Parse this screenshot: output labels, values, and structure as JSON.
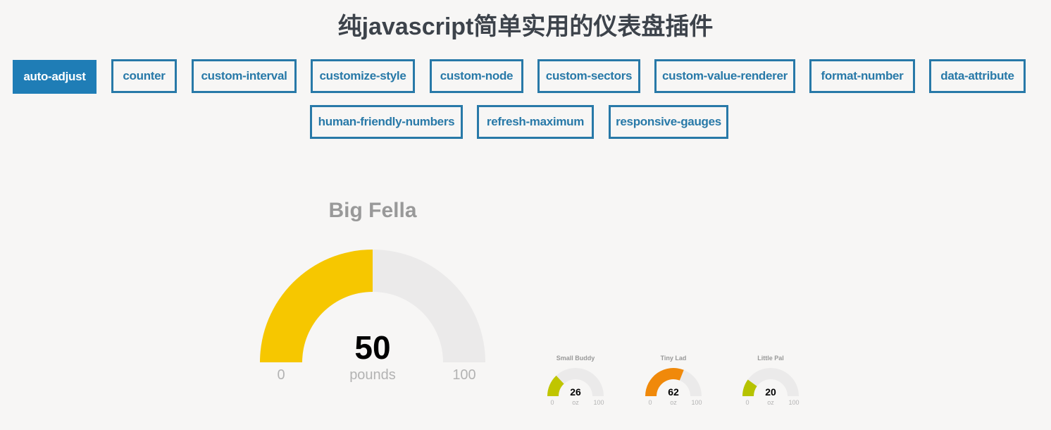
{
  "header": {
    "title": "纯javascript简单实用的仪表盘插件"
  },
  "tabs": [
    {
      "label": "auto-adjust",
      "active": true
    },
    {
      "label": "counter",
      "active": false
    },
    {
      "label": "custom-interval",
      "active": false
    },
    {
      "label": "customize-style",
      "active": false
    },
    {
      "label": "custom-node",
      "active": false
    },
    {
      "label": "custom-sectors",
      "active": false
    },
    {
      "label": "custom-value-renderer",
      "active": false
    },
    {
      "label": "format-number",
      "active": false
    },
    {
      "label": "data-attribute",
      "active": false
    },
    {
      "label": "human-friendly-numbers",
      "active": false
    },
    {
      "label": "refresh-maximum",
      "active": false
    },
    {
      "label": "responsive-gauges",
      "active": false
    }
  ],
  "gauges": [
    {
      "title": "Big Fella",
      "value": "50",
      "min": "0",
      "max": "100",
      "unit": "pounds",
      "fraction": 0.5,
      "color": "#f6c700"
    },
    {
      "title": "Small Buddy",
      "value": "26",
      "min": "0",
      "max": "100",
      "unit": "oz",
      "fraction": 0.26,
      "color": "#c0c500"
    },
    {
      "title": "Tiny Lad",
      "value": "62",
      "min": "0",
      "max": "100",
      "unit": "oz",
      "fraction": 0.62,
      "color": "#f0890a"
    },
    {
      "title": "Little Pal",
      "value": "20",
      "min": "0",
      "max": "100",
      "unit": "oz",
      "fraction": 0.2,
      "color": "#b6c300"
    }
  ],
  "colors": {
    "track": "#ebeaea",
    "accent": "#2879a8",
    "active_tab": "#1f7db6"
  }
}
